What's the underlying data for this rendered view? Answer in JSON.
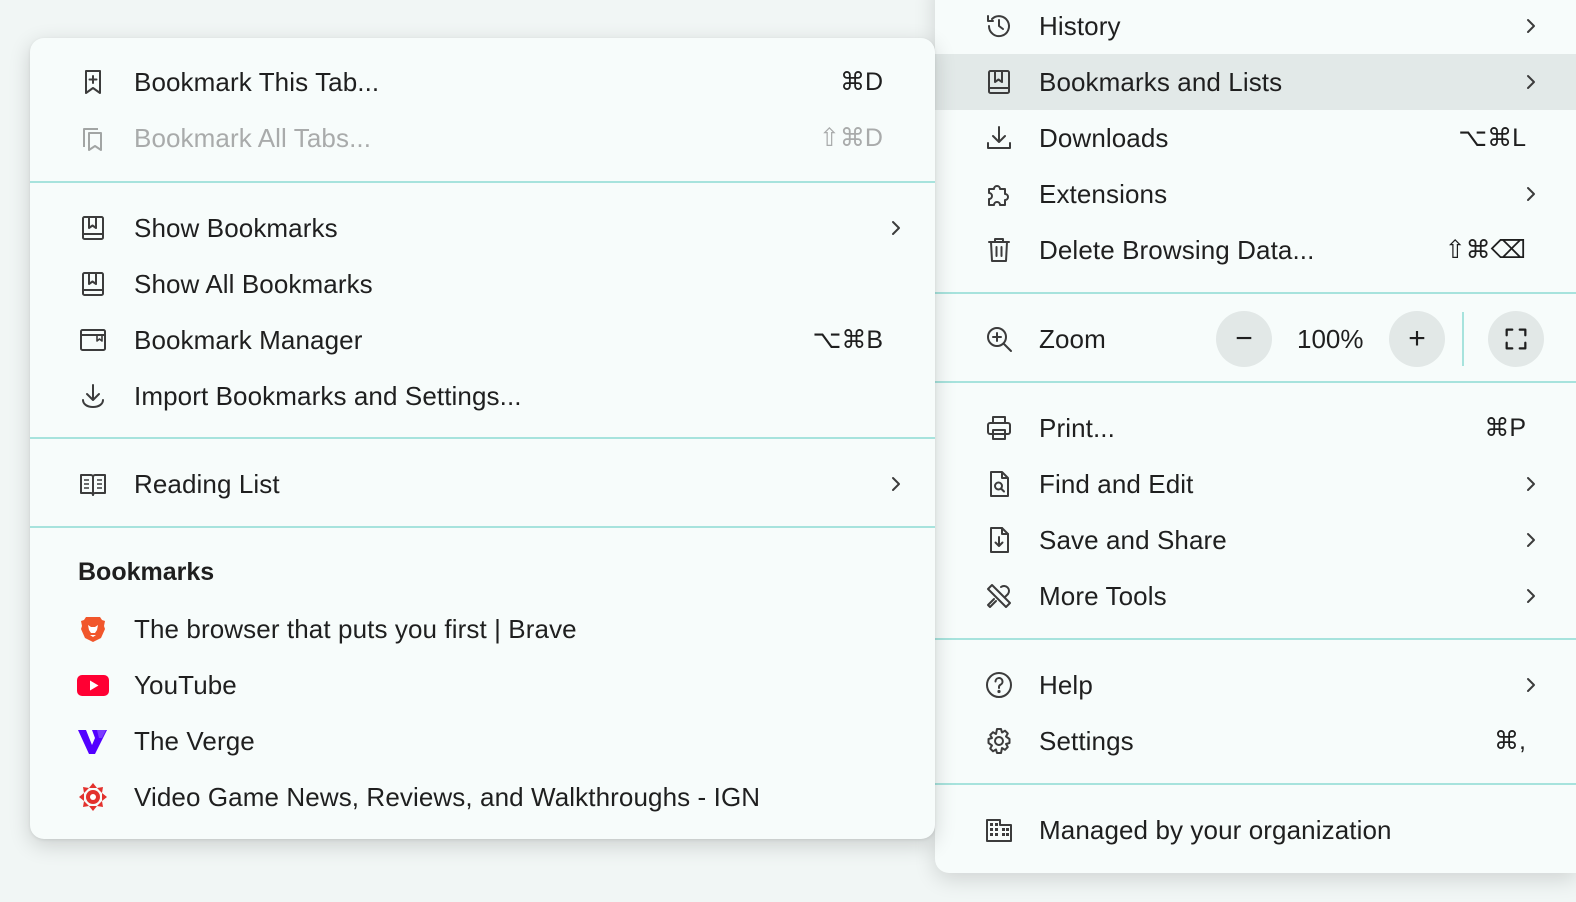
{
  "submenu": {
    "bookmark_this_tab": {
      "label": "Bookmark This Tab...",
      "shortcut": "⌘D"
    },
    "bookmark_all_tabs": {
      "label": "Bookmark All Tabs...",
      "shortcut": "⇧⌘D"
    },
    "show_bookmarks": {
      "label": "Show Bookmarks"
    },
    "show_all_bookmarks": {
      "label": "Show All Bookmarks"
    },
    "bookmark_manager": {
      "label": "Bookmark Manager",
      "shortcut": "⌥⌘B"
    },
    "import_bookmarks": {
      "label": "Import Bookmarks and Settings..."
    },
    "reading_list": {
      "label": "Reading List"
    },
    "bookmarks_section_title": "Bookmarks",
    "bookmarks": [
      {
        "label": "The browser that puts you first | Brave",
        "icon": "brave-lion-icon"
      },
      {
        "label": "YouTube",
        "icon": "youtube-icon"
      },
      {
        "label": "The Verge",
        "icon": "verge-icon"
      },
      {
        "label": "Video Game News, Reviews, and Walkthroughs - IGN",
        "icon": "ign-icon"
      }
    ]
  },
  "mainmenu": {
    "history": {
      "label": "History"
    },
    "bookmarks_and_lists": {
      "label": "Bookmarks and Lists"
    },
    "downloads": {
      "label": "Downloads",
      "shortcut": "⌥⌘L"
    },
    "extensions": {
      "label": "Extensions"
    },
    "delete_browsing_data": {
      "label": "Delete Browsing Data...",
      "shortcut": "⇧⌘⌫"
    },
    "zoom": {
      "label": "Zoom",
      "value": "100%",
      "minus": "−",
      "plus": "+"
    },
    "print": {
      "label": "Print...",
      "shortcut": "⌘P"
    },
    "find_and_edit": {
      "label": "Find and Edit"
    },
    "save_and_share": {
      "label": "Save and Share"
    },
    "more_tools": {
      "label": "More Tools"
    },
    "help": {
      "label": "Help"
    },
    "settings": {
      "label": "Settings",
      "shortcut": "⌘,"
    },
    "managed": {
      "label": "Managed by your organization"
    }
  },
  "colors": {
    "menu_bg": "#f7fcfb",
    "divider": "#a7e3dd",
    "highlight": "#e2e9e8",
    "brave": "#f1562b",
    "youtube": "#ff0033",
    "verge": "#5200ff",
    "ign": "#e3312d"
  }
}
